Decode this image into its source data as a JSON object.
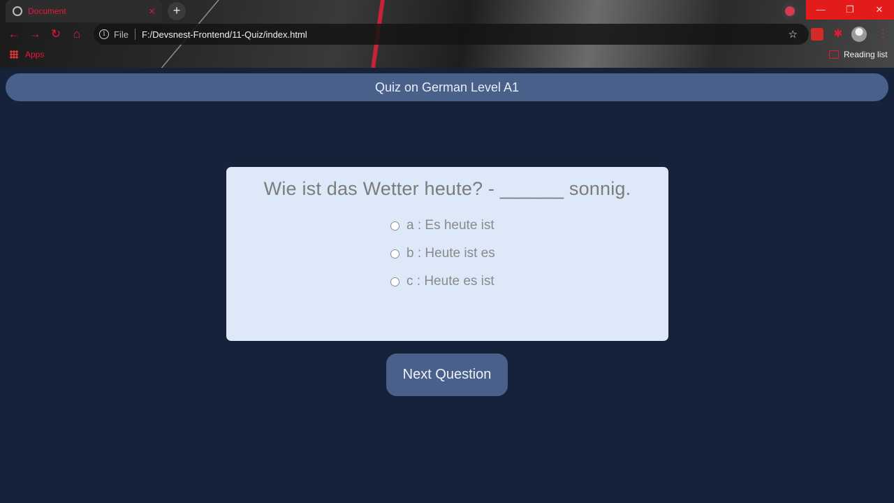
{
  "browser": {
    "tab": {
      "title": "Document",
      "close": "×"
    },
    "new_tab": "+",
    "window_controls": {
      "minimize": "—",
      "restore": "❐",
      "close": "✕"
    },
    "toolbar": {
      "back": "←",
      "forward": "→",
      "reload": "↻",
      "home": "⌂",
      "info": "i",
      "scheme": "File",
      "url": "F:/Devsnest-Frontend/11-Quiz/index.html",
      "star": "☆",
      "menu": "⋮"
    },
    "bookmarks": {
      "apps_label": "Apps",
      "reading_list_label": "Reading list"
    }
  },
  "page": {
    "header_title": "Quiz on German Level A1",
    "question": "Wie ist das Wetter heute? - ______ sonnig.",
    "options": [
      {
        "label": "a : Es heute ist"
      },
      {
        "label": "b : Heute ist es"
      },
      {
        "label": "c : Heute es ist"
      }
    ],
    "next_button": "Next Question"
  },
  "colors": {
    "page_bg": "#15223a",
    "accent": "#48608a",
    "card_bg": "#dde8f8",
    "browser_accent": "#e8173a"
  }
}
